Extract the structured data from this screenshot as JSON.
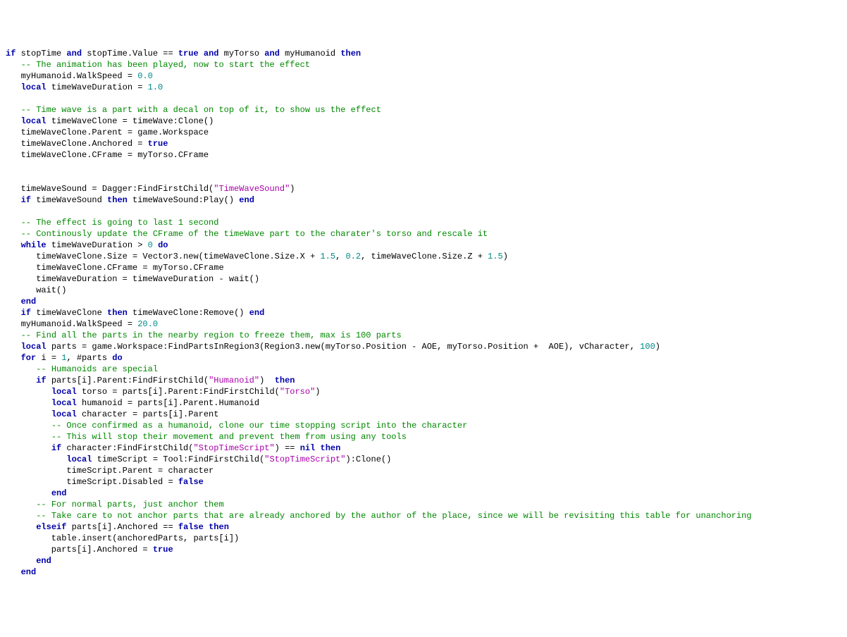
{
  "code": {
    "lines": [
      [
        {
          "c": "kw",
          "t": "if"
        },
        {
          "c": "pl",
          "t": " stopTime "
        },
        {
          "c": "kw",
          "t": "and"
        },
        {
          "c": "pl",
          "t": " stopTime.Value == "
        },
        {
          "c": "kw",
          "t": "true"
        },
        {
          "c": "pl",
          "t": " "
        },
        {
          "c": "kw",
          "t": "and"
        },
        {
          "c": "pl",
          "t": " myTorso "
        },
        {
          "c": "kw",
          "t": "and"
        },
        {
          "c": "pl",
          "t": " myHumanoid "
        },
        {
          "c": "kw",
          "t": "then"
        }
      ],
      [
        {
          "c": "pl",
          "t": "   "
        },
        {
          "c": "com",
          "t": "-- The animation has been played, now to start the effect"
        }
      ],
      [
        {
          "c": "pl",
          "t": "   myHumanoid.WalkSpeed = "
        },
        {
          "c": "num",
          "t": "0.0"
        }
      ],
      [
        {
          "c": "pl",
          "t": "   "
        },
        {
          "c": "kw",
          "t": "local"
        },
        {
          "c": "pl",
          "t": " timeWaveDuration = "
        },
        {
          "c": "num",
          "t": "1.0"
        }
      ],
      [
        {
          "c": "pl",
          "t": " "
        }
      ],
      [
        {
          "c": "pl",
          "t": "   "
        },
        {
          "c": "com",
          "t": "-- Time wave is a part with a decal on top of it, to show us the effect"
        }
      ],
      [
        {
          "c": "pl",
          "t": "   "
        },
        {
          "c": "kw",
          "t": "local"
        },
        {
          "c": "pl",
          "t": " timeWaveClone = timeWave:Clone()"
        }
      ],
      [
        {
          "c": "pl",
          "t": "   timeWaveClone.Parent = game.Workspace"
        }
      ],
      [
        {
          "c": "pl",
          "t": "   timeWaveClone.Anchored = "
        },
        {
          "c": "kw",
          "t": "true"
        }
      ],
      [
        {
          "c": "pl",
          "t": "   timeWaveClone.CFrame = myTorso.CFrame"
        }
      ],
      [
        {
          "c": "pl",
          "t": " "
        }
      ],
      [
        {
          "c": "pl",
          "t": " "
        }
      ],
      [
        {
          "c": "pl",
          "t": "   timeWaveSound = Dagger:FindFirstChild("
        },
        {
          "c": "str",
          "t": "\"TimeWaveSound\""
        },
        {
          "c": "pl",
          "t": ")"
        }
      ],
      [
        {
          "c": "pl",
          "t": "   "
        },
        {
          "c": "kw",
          "t": "if"
        },
        {
          "c": "pl",
          "t": " timeWaveSound "
        },
        {
          "c": "kw",
          "t": "then"
        },
        {
          "c": "pl",
          "t": " timeWaveSound:Play() "
        },
        {
          "c": "kw",
          "t": "end"
        }
      ],
      [
        {
          "c": "pl",
          "t": " "
        }
      ],
      [
        {
          "c": "pl",
          "t": "   "
        },
        {
          "c": "com",
          "t": "-- The effect is going to last 1 second"
        }
      ],
      [
        {
          "c": "pl",
          "t": "   "
        },
        {
          "c": "com",
          "t": "-- Continously update the CFrame of the timeWave part to the charater's torso and rescale it"
        }
      ],
      [
        {
          "c": "pl",
          "t": "   "
        },
        {
          "c": "kw",
          "t": "while"
        },
        {
          "c": "pl",
          "t": " timeWaveDuration > "
        },
        {
          "c": "num",
          "t": "0"
        },
        {
          "c": "pl",
          "t": " "
        },
        {
          "c": "kw",
          "t": "do"
        }
      ],
      [
        {
          "c": "pl",
          "t": "      timeWaveClone.Size = Vector3.new(timeWaveClone.Size.X + "
        },
        {
          "c": "num",
          "t": "1.5"
        },
        {
          "c": "pl",
          "t": ", "
        },
        {
          "c": "num",
          "t": "0.2"
        },
        {
          "c": "pl",
          "t": ", timeWaveClone.Size.Z + "
        },
        {
          "c": "num",
          "t": "1.5"
        },
        {
          "c": "pl",
          "t": ")"
        }
      ],
      [
        {
          "c": "pl",
          "t": "      timeWaveClone.CFrame = myTorso.CFrame"
        }
      ],
      [
        {
          "c": "pl",
          "t": "      timeWaveDuration = timeWaveDuration - wait()"
        }
      ],
      [
        {
          "c": "pl",
          "t": "      wait()"
        }
      ],
      [
        {
          "c": "pl",
          "t": "   "
        },
        {
          "c": "kw",
          "t": "end"
        }
      ],
      [
        {
          "c": "pl",
          "t": "   "
        },
        {
          "c": "kw",
          "t": "if"
        },
        {
          "c": "pl",
          "t": " timeWaveClone "
        },
        {
          "c": "kw",
          "t": "then"
        },
        {
          "c": "pl",
          "t": " timeWaveClone:Remove() "
        },
        {
          "c": "kw",
          "t": "end"
        }
      ],
      [
        {
          "c": "pl",
          "t": "   myHumanoid.WalkSpeed = "
        },
        {
          "c": "num",
          "t": "20.0"
        }
      ],
      [
        {
          "c": "pl",
          "t": "   "
        },
        {
          "c": "com",
          "t": "-- Find all the parts in the nearby region to freeze them, max is 100 parts"
        }
      ],
      [
        {
          "c": "pl",
          "t": "   "
        },
        {
          "c": "kw",
          "t": "local"
        },
        {
          "c": "pl",
          "t": " parts = game.Workspace:FindPartsInRegion3(Region3.new(myTorso.Position - AOE, myTorso.Position +  AOE), vCharacter, "
        },
        {
          "c": "num",
          "t": "100"
        },
        {
          "c": "pl",
          "t": ")"
        }
      ],
      [
        {
          "c": "pl",
          "t": "   "
        },
        {
          "c": "kw",
          "t": "for"
        },
        {
          "c": "pl",
          "t": " i = "
        },
        {
          "c": "num",
          "t": "1"
        },
        {
          "c": "pl",
          "t": ", #parts "
        },
        {
          "c": "kw",
          "t": "do"
        }
      ],
      [
        {
          "c": "pl",
          "t": "      "
        },
        {
          "c": "com",
          "t": "-- Humanoids are special"
        }
      ],
      [
        {
          "c": "pl",
          "t": "      "
        },
        {
          "c": "kw",
          "t": "if"
        },
        {
          "c": "pl",
          "t": " parts[i].Parent:FindFirstChild("
        },
        {
          "c": "str",
          "t": "\"Humanoid\""
        },
        {
          "c": "pl",
          "t": ")  "
        },
        {
          "c": "kw",
          "t": "then"
        }
      ],
      [
        {
          "c": "pl",
          "t": "         "
        },
        {
          "c": "kw",
          "t": "local"
        },
        {
          "c": "pl",
          "t": " torso = parts[i].Parent:FindFirstChild("
        },
        {
          "c": "str",
          "t": "\"Torso\""
        },
        {
          "c": "pl",
          "t": ")"
        }
      ],
      [
        {
          "c": "pl",
          "t": "         "
        },
        {
          "c": "kw",
          "t": "local"
        },
        {
          "c": "pl",
          "t": " humanoid = parts[i].Parent.Humanoid"
        }
      ],
      [
        {
          "c": "pl",
          "t": "         "
        },
        {
          "c": "kw",
          "t": "local"
        },
        {
          "c": "pl",
          "t": " character = parts[i].Parent"
        }
      ],
      [
        {
          "c": "pl",
          "t": "         "
        },
        {
          "c": "com",
          "t": "-- Once confirmed as a humanoid, clone our time stopping script into the character"
        }
      ],
      [
        {
          "c": "pl",
          "t": "         "
        },
        {
          "c": "com",
          "t": "-- This will stop their movement and prevent them from using any tools"
        }
      ],
      [
        {
          "c": "pl",
          "t": "         "
        },
        {
          "c": "kw",
          "t": "if"
        },
        {
          "c": "pl",
          "t": " character:FindFirstChild("
        },
        {
          "c": "str",
          "t": "\"StopTimeScript\""
        },
        {
          "c": "pl",
          "t": ") == "
        },
        {
          "c": "kw",
          "t": "nil"
        },
        {
          "c": "pl",
          "t": " "
        },
        {
          "c": "kw",
          "t": "then"
        }
      ],
      [
        {
          "c": "pl",
          "t": "            "
        },
        {
          "c": "kw",
          "t": "local"
        },
        {
          "c": "pl",
          "t": " timeScript = Tool:FindFirstChild("
        },
        {
          "c": "str",
          "t": "\"StopTimeScript\""
        },
        {
          "c": "pl",
          "t": "):Clone()"
        }
      ],
      [
        {
          "c": "pl",
          "t": "            timeScript.Parent = character"
        }
      ],
      [
        {
          "c": "pl",
          "t": "            timeScript.Disabled = "
        },
        {
          "c": "kw",
          "t": "false"
        }
      ],
      [
        {
          "c": "pl",
          "t": "         "
        },
        {
          "c": "kw",
          "t": "end"
        }
      ],
      [
        {
          "c": "pl",
          "t": "      "
        },
        {
          "c": "com",
          "t": "-- For normal parts, just anchor them"
        }
      ],
      [
        {
          "c": "pl",
          "t": "      "
        },
        {
          "c": "com",
          "t": "-- Take care to not anchor parts that are already anchored by the author of the place, since we will be revisiting this table for unanchoring"
        }
      ],
      [
        {
          "c": "pl",
          "t": "      "
        },
        {
          "c": "kw",
          "t": "elseif"
        },
        {
          "c": "pl",
          "t": " parts[i].Anchored == "
        },
        {
          "c": "kw",
          "t": "false"
        },
        {
          "c": "pl",
          "t": " "
        },
        {
          "c": "kw",
          "t": "then"
        }
      ],
      [
        {
          "c": "pl",
          "t": "         table.insert(anchoredParts, parts[i])"
        }
      ],
      [
        {
          "c": "pl",
          "t": "         parts[i].Anchored = "
        },
        {
          "c": "kw",
          "t": "true"
        }
      ],
      [
        {
          "c": "pl",
          "t": "      "
        },
        {
          "c": "kw",
          "t": "end"
        }
      ],
      [
        {
          "c": "pl",
          "t": "   "
        },
        {
          "c": "kw",
          "t": "end"
        }
      ]
    ]
  }
}
